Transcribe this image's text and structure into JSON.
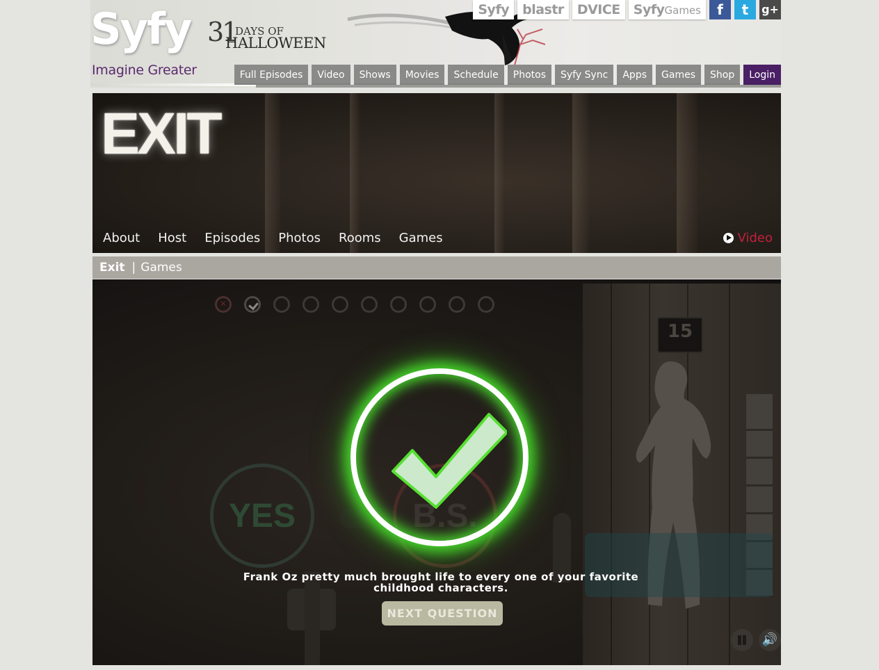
{
  "header": {
    "logo": "Syfy",
    "tagline": "Imagine Greater",
    "promo": {
      "number": "31",
      "line1": "DAYS OF",
      "line2": "HALLOWEEN"
    }
  },
  "network_tabs": [
    {
      "main": "Syfy",
      "sub": ""
    },
    {
      "main": "blastr",
      "sub": ""
    },
    {
      "main": "DVICE",
      "sub": ""
    },
    {
      "main": "Syfy",
      "sub": "Games"
    }
  ],
  "social": {
    "facebook": {
      "glyph": "f",
      "color": "#3b5998"
    },
    "twitter": {
      "glyph": "t",
      "color": "#2aa9e0"
    },
    "google": {
      "glyph": "g+",
      "color": "#4a4a4a"
    }
  },
  "nav": [
    "Full Episodes",
    "Video",
    "Shows",
    "Movies",
    "Schedule",
    "Photos",
    "Syfy Sync",
    "Apps",
    "Games",
    "Shop",
    "Login"
  ],
  "hero": {
    "title": "EXIT",
    "show_nav": [
      "About",
      "Host",
      "Episodes",
      "Photos",
      "Rooms",
      "Games"
    ],
    "video": "Video"
  },
  "breadcrumb": {
    "first": "Exit",
    "separator": "|",
    "second": "Games"
  },
  "game": {
    "timer": "15",
    "yes": "YES",
    "bs": "B.S.",
    "question": "Frank Oz pretty much brought life to every one of your favorite childhood characters.",
    "next_button": "NEXT QUESTION",
    "progress": [
      "wrong",
      "right",
      "empty",
      "empty",
      "empty",
      "empty",
      "empty",
      "empty",
      "empty",
      "empty"
    ],
    "accent_glow": "#45d22a"
  }
}
